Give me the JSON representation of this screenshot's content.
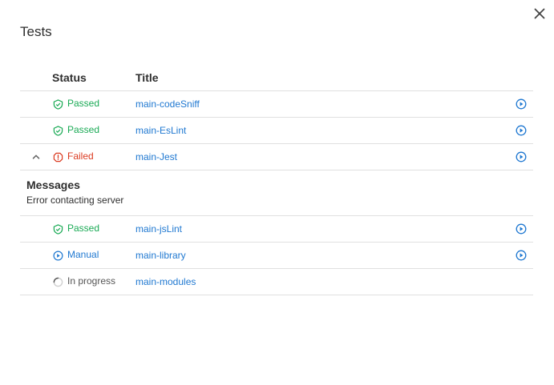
{
  "modal": {
    "title": "Tests",
    "close_icon": "close-icon"
  },
  "table": {
    "headers": {
      "status": "Status",
      "title": "Title"
    },
    "rows": [
      {
        "status": "Passed",
        "status_icon": "check-shield-icon",
        "title": "main-codeSniff",
        "action_icon": "play-circle-icon"
      },
      {
        "status": "Passed",
        "status_icon": "check-shield-icon",
        "title": "main-EsLint",
        "action_icon": "play-circle-icon"
      },
      {
        "status": "Failed",
        "status_icon": "error-icon",
        "title": "main-Jest",
        "action_icon": "play-circle-icon",
        "expanded": true,
        "toggle_icon": "chevron-up-icon"
      },
      {
        "status": "Passed",
        "status_icon": "check-shield-icon",
        "title": "main-jsLint",
        "action_icon": "play-circle-icon"
      },
      {
        "status": "Manual",
        "status_icon": "play-circle-icon",
        "title": "main-library",
        "action_icon": "play-circle-icon"
      },
      {
        "status": "In progress",
        "status_icon": "spinner-icon",
        "title": "main-modules"
      }
    ],
    "messages": {
      "heading": "Messages",
      "text": "Error contacting server"
    }
  },
  "colors": {
    "passed": "#1aaa55",
    "failed": "#db3b21",
    "link": "#1f78d1",
    "border": "#e0e0e0"
  }
}
